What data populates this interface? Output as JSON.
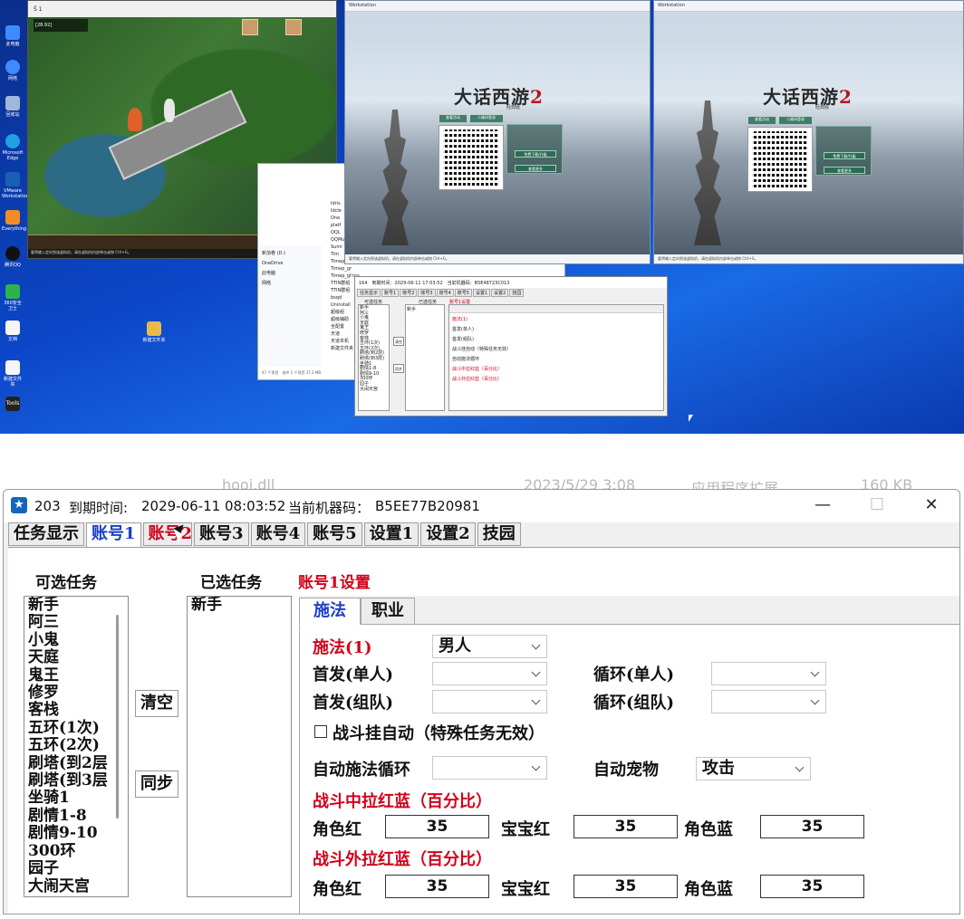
{
  "desktop": {
    "game_window": {
      "title": "Ŝ 1",
      "player_name": "[28.92]",
      "status_note": "要将输入定向到该虚拟机，请在虚拟机内部单击或按 Ctrl+G。"
    },
    "vm_windows": [
      {
        "tab": "Workstation",
        "logo_main": "大话西游",
        "logo_num": "2",
        "sub": "经典版",
        "btn_a": "查看活动",
        "btn_b": "二维码登录",
        "btn_c": "免费下载/升级",
        "btn_d": "查看更多",
        "status_note": "要将输入定向到该虚拟机，请在虚拟机内部单击或按 Ctrl+G。"
      },
      {
        "tab": "Workstation",
        "logo_main": "大话西游",
        "logo_num": "2",
        "sub": "经典版",
        "btn_a": "查看活动",
        "btn_b": "二维码登录",
        "btn_c": "免费下载/升级",
        "btn_d": "查看更多",
        "status_note": "要将输入定向到该虚拟机，请在虚拟机内部单击或按 Ctrl+G。"
      }
    ],
    "explorer": {
      "side": [
        "新加卷 (D:)",
        "OneDrive",
        "此电脑",
        "网络"
      ],
      "files": [
        "Idris",
        "Idcle",
        "One",
        "platf",
        "QQL",
        "QQMu",
        "Sumi",
        "Tim",
        "Timep",
        "Timep_gr",
        "Timep_gf.tps",
        "TTIN群组",
        "TTIN群组",
        "bsqd",
        "Uninstall",
        "超级组",
        "超级辅助",
        "全配置",
        "天道",
        "天道本机",
        "新建文件夹"
      ],
      "footer": "47 个项目　选中 1 个项目 37.2 MB"
    },
    "mini_tool": {
      "title": "164　到期时间：2029-06-11 17:03:52　当前机器码：B5E48723C013",
      "tabs": [
        "任务显示",
        "账号1",
        "账号2",
        "账号3",
        "账号4",
        "账号5",
        "设置1",
        "设置2",
        "技园"
      ],
      "col_a": "可选任务",
      "col_b": "已选任务",
      "col_c": "账号1设置",
      "list": [
        "新手",
        "阿三",
        "小鬼",
        "天庭",
        "鬼王",
        "修罗",
        "客栈",
        "五环(1次)",
        "五环(2次)",
        "刷塔(到2层)",
        "刷塔(到3层)",
        "坐骑1",
        "剧情1-8",
        "剧情9-10",
        "300环",
        "园子",
        "大闹天宫"
      ],
      "selected": "新手",
      "btn_clear": "清空",
      "btn_sync": "同步"
    },
    "icons": [
      "此电脑",
      "网络",
      "回收站",
      "Microsoft Edge",
      "VMware Workstation",
      "Everything",
      "腾讯QQ",
      "360安全卫士",
      "Tools",
      "文档",
      "新建文件夹"
    ],
    "folder_icon_label": "新建文件夹"
  },
  "ghost_row": {
    "file": "hooj.dll",
    "date": "2023/5/29 3:08",
    "type": "应用程序扩展",
    "size": "160 KB"
  },
  "window": {
    "id": "203",
    "expire_label": "到期时间:",
    "expire_value": "2029-06-11 08:03:52",
    "machine_label": "当前机器码：",
    "machine_value": "B5EE77B20981",
    "min_glyph": "—",
    "max_glyph": "☐",
    "close_glyph": "✕"
  },
  "tabs": [
    {
      "label": "任务显示",
      "state": "normal"
    },
    {
      "label": "账号1",
      "state": "active"
    },
    {
      "label": "账号2",
      "state": "hover"
    },
    {
      "label": "账号3",
      "state": "normal"
    },
    {
      "label": "账号4",
      "state": "normal"
    },
    {
      "label": "账号5",
      "state": "normal"
    },
    {
      "label": "设置1",
      "state": "normal"
    },
    {
      "label": "设置2",
      "state": "normal"
    },
    {
      "label": "技园",
      "state": "normal"
    }
  ],
  "tasks": {
    "available_label": "可选任务",
    "selected_label": "已选任务",
    "available": [
      "新手",
      "阿三",
      "小鬼",
      "天庭",
      "鬼王",
      "修罗",
      "客栈",
      "五环(1次)",
      "五环(2次)",
      "刷塔(到2层",
      "刷塔(到3层",
      "坐骑1",
      "剧情1-8",
      "剧情9-10",
      "300环",
      "园子",
      "大闹天宫"
    ],
    "selected": [
      "新手"
    ],
    "clear_button": "清空",
    "sync_button": "同步"
  },
  "settings": {
    "header": "账号1设置",
    "subtabs": [
      "施法",
      "职业"
    ],
    "active_subtab": "施法",
    "cast_label": "施法(1)",
    "cast_value": "男人",
    "first_single_label": "首发(单人)",
    "first_single_value": "",
    "loop_single_label": "循环(单人)",
    "loop_single_value": "",
    "first_team_label": "首发(组队)",
    "first_team_value": "",
    "loop_team_label": "循环(组队)",
    "loop_team_value": "",
    "auto_fight_label": "战斗挂自动（特殊任务无效）",
    "auto_fight_checked": false,
    "auto_cast_label": "自动施法循环",
    "auto_cast_value": "",
    "auto_pet_label": "自动宠物",
    "auto_pet_value": "攻击",
    "in_battle_header": "战斗中拉红蓝（百分比）",
    "out_battle_header": "战斗外拉红蓝（百分比）",
    "role_red_label": "角色红",
    "pet_red_label": "宝宝红",
    "role_blue_label": "角色蓝",
    "in_battle": {
      "role_red": "35",
      "pet_red": "35",
      "role_blue": "35"
    },
    "out_battle": {
      "role_red": "35",
      "pet_red": "35",
      "role_blue": "35"
    }
  },
  "colors": {
    "accent_blue": "#1b3fc7",
    "alert_red": "#d0021b",
    "desktop_blue": "#0b46c8"
  }
}
